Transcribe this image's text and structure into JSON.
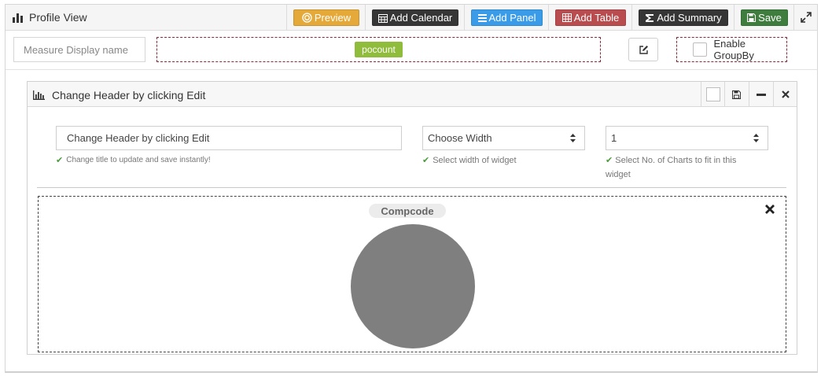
{
  "toolbar": {
    "title": "Profile View",
    "buttons": {
      "preview": "Preview",
      "add_calendar": "Add Calendar",
      "add_panel": "Add Panel",
      "add_table": "Add Table",
      "add_summary": "Add Summary",
      "save": "Save"
    },
    "colors": {
      "preview": "#e5a93a",
      "add_calendar": "#363636",
      "add_panel": "#3a9ce8",
      "add_table": "#b84c4f",
      "add_summary": "#363636",
      "save": "#3f7d3f"
    }
  },
  "measure": {
    "placeholder": "Measure Display name",
    "drop_pill": "pocount",
    "groupby_label": "Enable GroupBy"
  },
  "widget": {
    "header": "Change Header by clicking Edit",
    "title_input": "Change Header by clicking Edit",
    "title_help": "Change title to update and save instantly!",
    "width_select": "Choose Width",
    "width_help": "Select width of widget",
    "count_select": "1",
    "count_help": "Select No. of Charts to fit in this widget",
    "chart": {
      "label": "Compcode",
      "slice_color": "#7f7f7f"
    }
  },
  "chart_data": {
    "type": "pie",
    "title": "Compcode",
    "categories": [
      ""
    ],
    "values": [
      1
    ]
  }
}
